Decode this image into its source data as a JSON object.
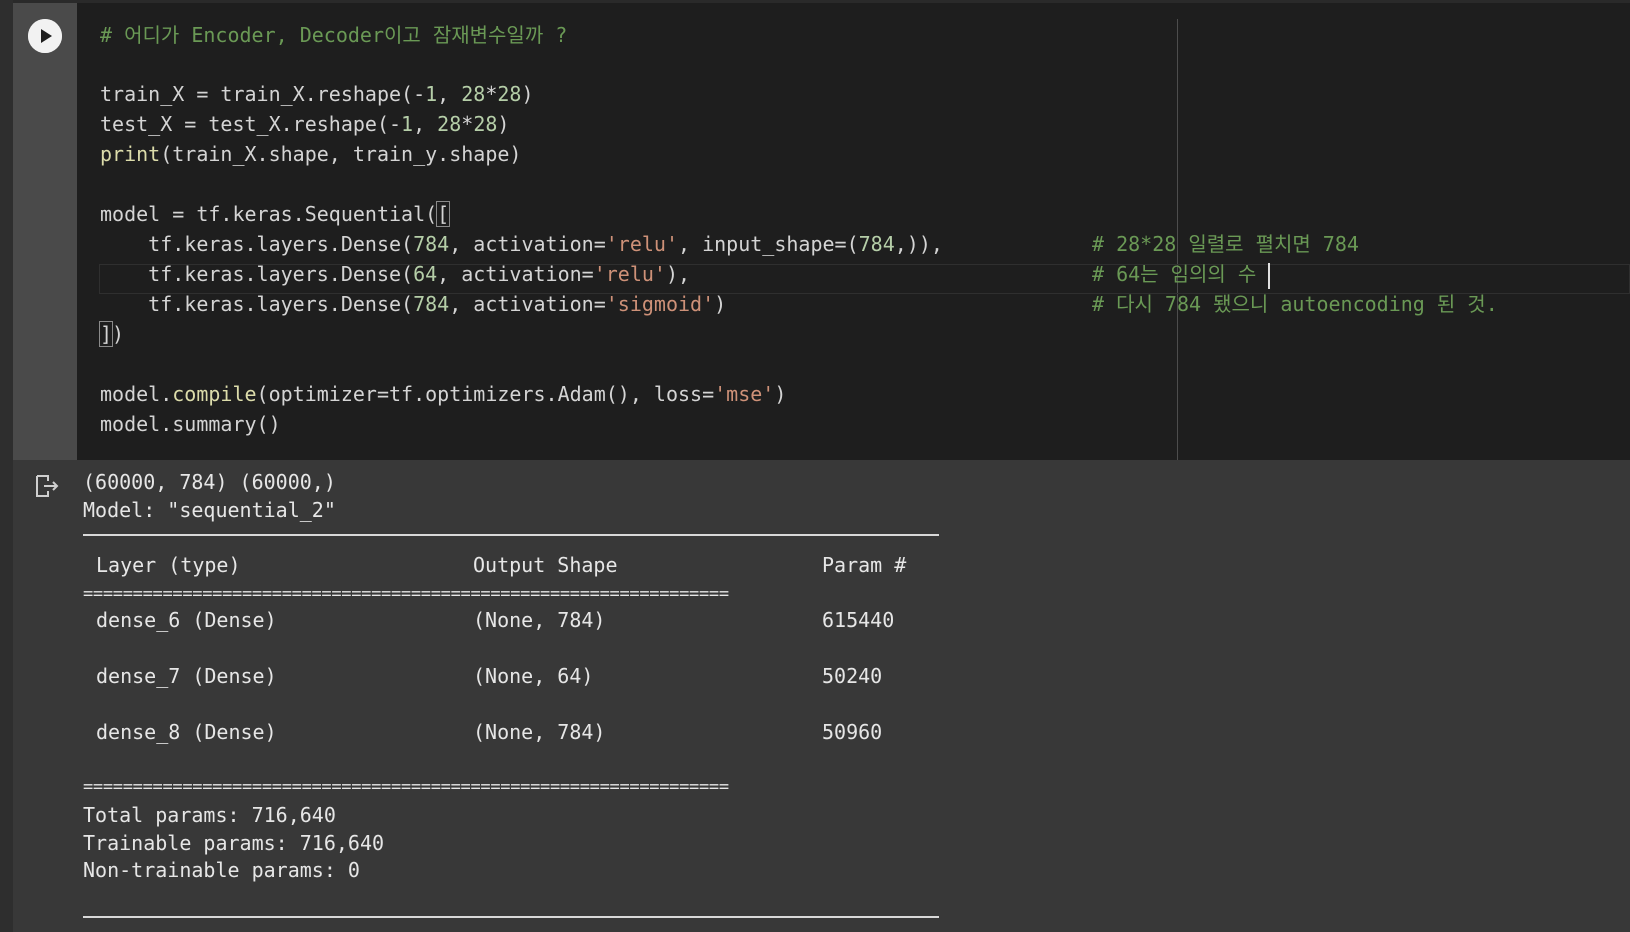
{
  "code": {
    "comment_title": "# 어디가 Encoder, Decoder이고 잠재변수일까 ?",
    "line_reshape_train": {
      "a": "train_X = train_X.reshape(-",
      "n1": "1",
      "b": ", ",
      "n2": "28",
      "c": "*",
      "n3": "28",
      "d": ")"
    },
    "line_reshape_test": {
      "a": "test_X = test_X.reshape(-",
      "n1": "1",
      "b": ", ",
      "n2": "28",
      "c": "*",
      "n3": "28",
      "d": ")"
    },
    "line_print": {
      "fn": "print",
      "rest": "(train_X.shape, train_y.shape)"
    },
    "line_model": {
      "a": "model = tf.keras.Sequential(",
      "bracket": "["
    },
    "line_dense1": {
      "a": "    tf.keras.layers.Dense(",
      "n1": "784",
      "b": ", activation=",
      "s": "'relu'",
      "c": ", input_shape=(",
      "n2": "784",
      "d": ",)),",
      "comment": "# 28*28 일렬로 펼치면 784"
    },
    "line_dense2": {
      "a": "    tf.keras.layers.Dense(",
      "n1": "64",
      "b": ", activation=",
      "s": "'relu'",
      "c": "),",
      "comment": "# 64는 임의의 수 "
    },
    "line_dense3": {
      "a": "    tf.keras.layers.Dense(",
      "n1": "784",
      "b": ", activation=",
      "s": "'sigmoid'",
      "c": ")",
      "comment": "# 다시 784 됐으니 autoencoding 된 것."
    },
    "line_close": {
      "bracket": "]",
      "rest": ")"
    },
    "line_compile": {
      "a": "model.",
      "fn": "compile",
      "b": "(optimizer=tf.optimizers.Adam(), loss=",
      "s": "'mse'",
      "c": ")"
    },
    "line_summary": "model.summary()"
  },
  "output": {
    "shapes": "(60000, 784) (60000,)",
    "model_name": "Model: \"sequential_2\"",
    "header": {
      "layer": "Layer (type)",
      "shape": "Output Shape",
      "param": "Param #"
    },
    "double_rule": "=================================================================",
    "rows": [
      {
        "layer": "dense_6 (Dense)",
        "shape": "(None, 784)",
        "param": "615440"
      },
      {
        "layer": "dense_7 (Dense)",
        "shape": "(None, 64)",
        "param": "50240"
      },
      {
        "layer": "dense_8 (Dense)",
        "shape": "(None, 784)",
        "param": "50960"
      }
    ],
    "total": "Total params: 716,640",
    "trainable": "Trainable params: 716,640",
    "non_trainable": "Non-trainable params: 0"
  },
  "colors": {
    "editor_bg": "#1e1e1e",
    "output_bg": "#383838",
    "comment": "#6a9955",
    "string": "#ce9178",
    "number": "#b5cea8",
    "function": "#dcdcaa"
  },
  "icons": {
    "run": "play-icon",
    "output": "output-arrow-icon"
  }
}
